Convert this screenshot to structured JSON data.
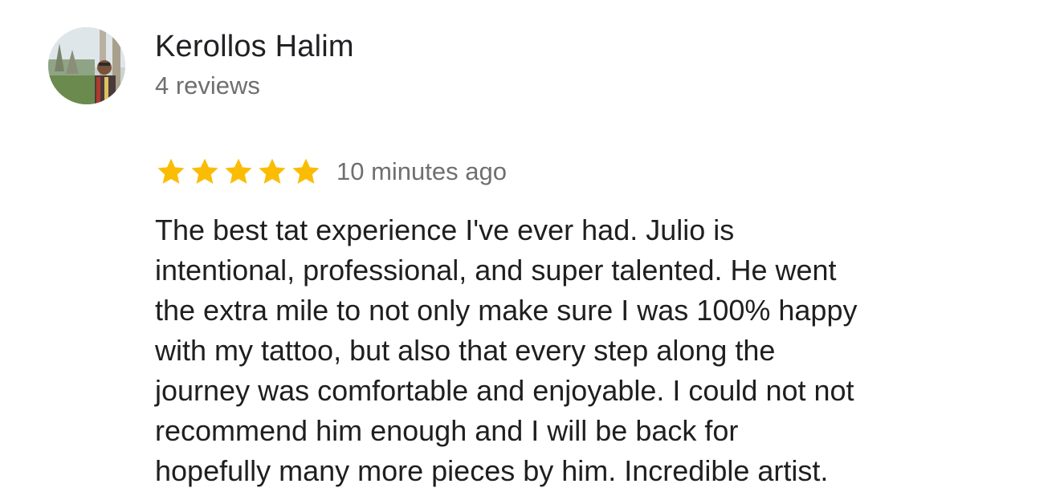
{
  "reviewer": {
    "name": "Kerollos Halim",
    "review_count": "4 reviews",
    "avatar_icon": "profile-photo"
  },
  "review": {
    "rating": 5,
    "rating_max": 5,
    "star_color": "#fbbc04",
    "star_icon": "star-icon",
    "time_ago": "10 minutes ago",
    "text_lines": [
      "The best tat experience I've ever had. Julio is",
      "intentional, professional, and super talented. He went",
      "the extra mile to not only make sure I was 100% happy",
      "with my tattoo, but also that every step along the",
      "journey was comfortable and enjoyable. I could not not",
      "recommend him enough and I will be back for",
      "hopefully many more pieces by him. Incredible artist."
    ]
  }
}
